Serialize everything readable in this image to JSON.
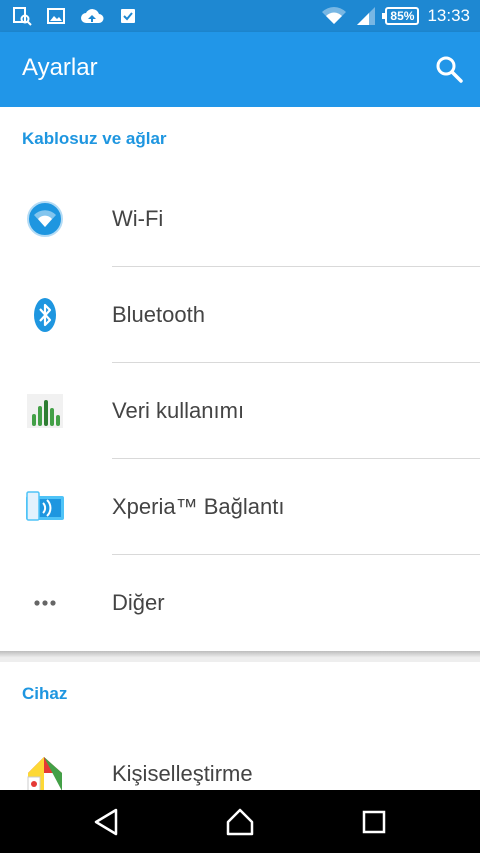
{
  "status_bar": {
    "icons_left": [
      "screenshot-search-icon",
      "image-icon",
      "cloud-upload-icon",
      "checkbox-icon"
    ],
    "icons_right": [
      "wifi-icon",
      "signal-icon"
    ],
    "battery": "85%",
    "time": "13:33"
  },
  "app_bar": {
    "title": "Ayarlar",
    "search_icon": "search-icon"
  },
  "sections": [
    {
      "header": "Kablosuz ve ağlar",
      "items": [
        {
          "label": "Wi-Fi",
          "icon": "wifi-settings-icon"
        },
        {
          "label": "Bluetooth",
          "icon": "bluetooth-icon"
        },
        {
          "label": "Veri kullanımı",
          "icon": "data-usage-icon"
        },
        {
          "label": "Xperia™ Bağlantı",
          "icon": "xperia-connectivity-icon"
        },
        {
          "label": "Diğer",
          "icon": "more-dots-icon"
        }
      ]
    },
    {
      "header": "Cihaz",
      "items": [
        {
          "label": "Kişiselleştirme",
          "icon": "personalization-icon"
        }
      ]
    }
  ],
  "nav_bar": {
    "buttons": [
      "back-icon",
      "home-icon",
      "recents-icon"
    ]
  },
  "colors": {
    "status_bar": "#1e88d2",
    "app_bar": "#2196e8",
    "section_header": "#1e96e0",
    "label": "#444444"
  }
}
